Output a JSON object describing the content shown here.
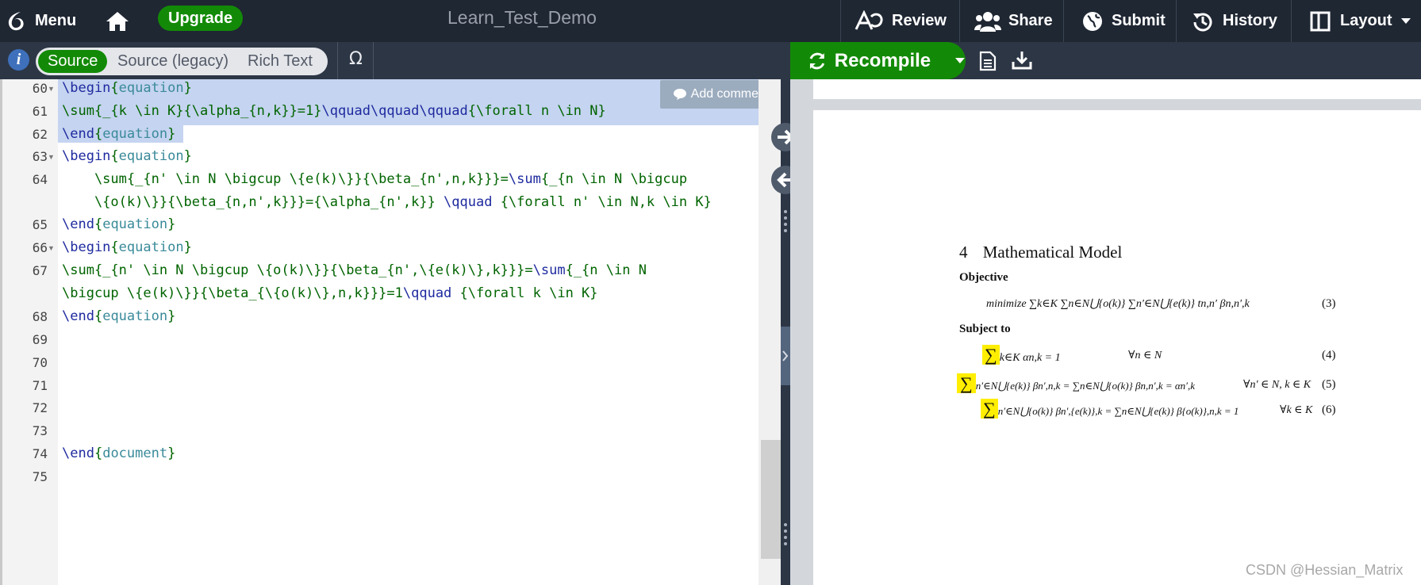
{
  "topbar": {
    "menu_label": "Menu",
    "upgrade_label": "Upgrade",
    "project_title": "Learn_Test_Demo",
    "review_label": "Review",
    "share_label": "Share",
    "submit_label": "Submit",
    "history_label": "History",
    "layout_label": "Layout"
  },
  "editor_toolbar": {
    "info_icon": "i",
    "tabs": [
      "Source",
      "Source (legacy)",
      "Rich Text"
    ],
    "active_tab": "Source",
    "symbol_label": "Ω"
  },
  "pdf_toolbar": {
    "recompile_label": "Recompile"
  },
  "editor": {
    "add_comment_label": "Add comment",
    "line_numbers": [
      "60",
      "61",
      "62",
      "63",
      "64",
      "",
      "65",
      "66",
      "67",
      "",
      "68",
      "69",
      "70",
      "71",
      "72",
      "73",
      "74",
      "75"
    ],
    "lines": {
      "l60a": "\\begin",
      "l60b": "{",
      "l60c": "equation",
      "l60d": "}",
      "l61a": "\\sum{_{k \\in K}{\\alpha_{n,k}}=1}",
      "l61b": "\\qquad\\qquad\\qquad",
      "l61c": "{\\forall n \\in N}",
      "l62a": "\\end",
      "l62b": "{",
      "l62c": "equation",
      "l62d": "}",
      "l63a": "\\begin",
      "l63b": "{",
      "l63c": "equation",
      "l63d": "}",
      "l64a": "    \\sum{_{n' \\in N \\bigcup \\{e(k)\\}}{\\beta_{n',n,k}}}=",
      "l64b": "\\sum",
      "l64c": "{_{n \\in N \\bigcup",
      "l64d": "    \\{o(k)\\}}{\\beta_{n,n',k}}}={\\alpha_{n',k}} ",
      "l64e": "\\qquad",
      "l64f": " {\\forall n' \\in N,k \\in K}",
      "l65a": "\\end",
      "l65b": "{",
      "l65c": "equation",
      "l65d": "}",
      "l66a": "\\begin",
      "l66b": "{",
      "l66c": "equation",
      "l66d": "}",
      "l67a": "\\sum{_{n' \\in N \\bigcup \\{o(k)\\}}{\\beta_{n',\\{e(k)\\},k}}}=",
      "l67b": "\\sum",
      "l67c": "{_{n \\in N",
      "l67d": "\\bigcup \\{e(k)\\}}{\\beta_{\\{o(k)\\},n,k}}}=1",
      "l67e": "\\qquad",
      "l67f": " {\\forall k \\in K}",
      "l68a": "\\end",
      "l68b": "{",
      "l68c": "equation",
      "l68d": "}",
      "l74a": "\\end",
      "l74b": "{",
      "l74c": "document",
      "l74d": "}"
    }
  },
  "pdf": {
    "section_number": "4",
    "section_title": "Mathematical Model",
    "objective_label": "Objective",
    "subject_to_label": "Subject to",
    "eq3_text": "minimize ∑k∈K ∑n∈N⋃{o(k)} ∑n′∈N⋃{e(k)} tn,n′ βn,n′,k",
    "eq3_no": "(3)",
    "eq4_sum": "∑",
    "eq4_rest": "k∈K αn,k = 1",
    "eq4_forall": "∀n ∈ N",
    "eq4_no": "(4)",
    "eq5_sum": "∑",
    "eq5_rest": "n′∈N⋃{e(k)} βn′,n,k = ∑n∈N⋃{o(k)} βn,n′,k = αn′,k",
    "eq5_forall": "∀n′ ∈ N, k ∈ K",
    "eq5_no": "(5)",
    "eq6_sum": "∑",
    "eq6_rest": "n′∈N⋃{o(k)} βn′,{e(k)},k = ∑n∈N⋃{e(k)} β{o(k)},n,k = 1",
    "eq6_forall": "∀k ∈ K",
    "eq6_no": "(6)"
  },
  "watermark": "CSDN @Hessian_Matrix",
  "colors": {
    "topbar_bg": "#1f2733",
    "toolbar_bg": "#2c3645",
    "accent_green": "#138a07",
    "selection": "#c5d4f0",
    "pdf_highlight": "#ffee00"
  }
}
